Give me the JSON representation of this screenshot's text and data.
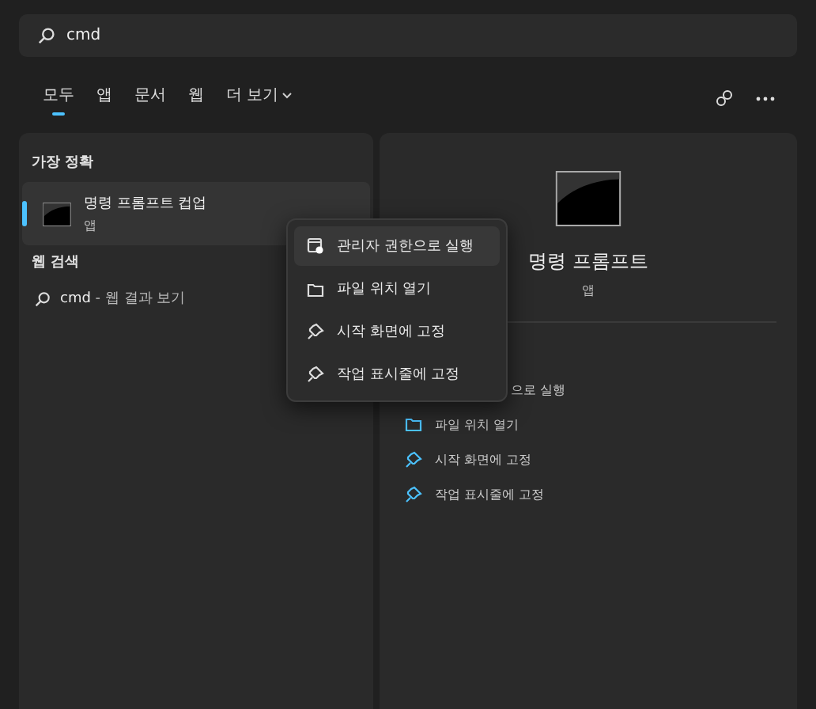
{
  "search": {
    "value": "cmd"
  },
  "tabs": [
    {
      "label": "모두",
      "selected": true
    },
    {
      "label": "앱",
      "selected": false
    },
    {
      "label": "문서",
      "selected": false
    },
    {
      "label": "웹",
      "selected": false
    },
    {
      "label": "더 보기",
      "selected": false
    }
  ],
  "best_match": {
    "heading": "가장 정확",
    "title": "명령 프롬프트 컵업",
    "subtitle": "앱",
    "selected": true
  },
  "web_search": {
    "heading": "웹 검색",
    "query": "cmd",
    "suffix": " - 웹 결과 보기"
  },
  "detail": {
    "title": "명령 프롬프트",
    "subtitle": "앱",
    "actions": [
      {
        "kind": "partial",
        "label": "으로 실행"
      },
      {
        "kind": "folder",
        "label": "파일 위치 열기"
      },
      {
        "kind": "pin",
        "label": "시작 화면에 고정"
      },
      {
        "kind": "pin",
        "label": "작업 표시줄에 고정"
      }
    ]
  },
  "context_menu": [
    {
      "kind": "admin",
      "label": "관리자 권한으로 실행",
      "selected": true
    },
    {
      "kind": "folder",
      "label": "파일 위치 열기",
      "selected": false
    },
    {
      "kind": "pin",
      "label": "시작 화면에 고정",
      "selected": false
    },
    {
      "kind": "pin",
      "label": "작업 표시줄에 고정",
      "selected": false
    }
  ]
}
